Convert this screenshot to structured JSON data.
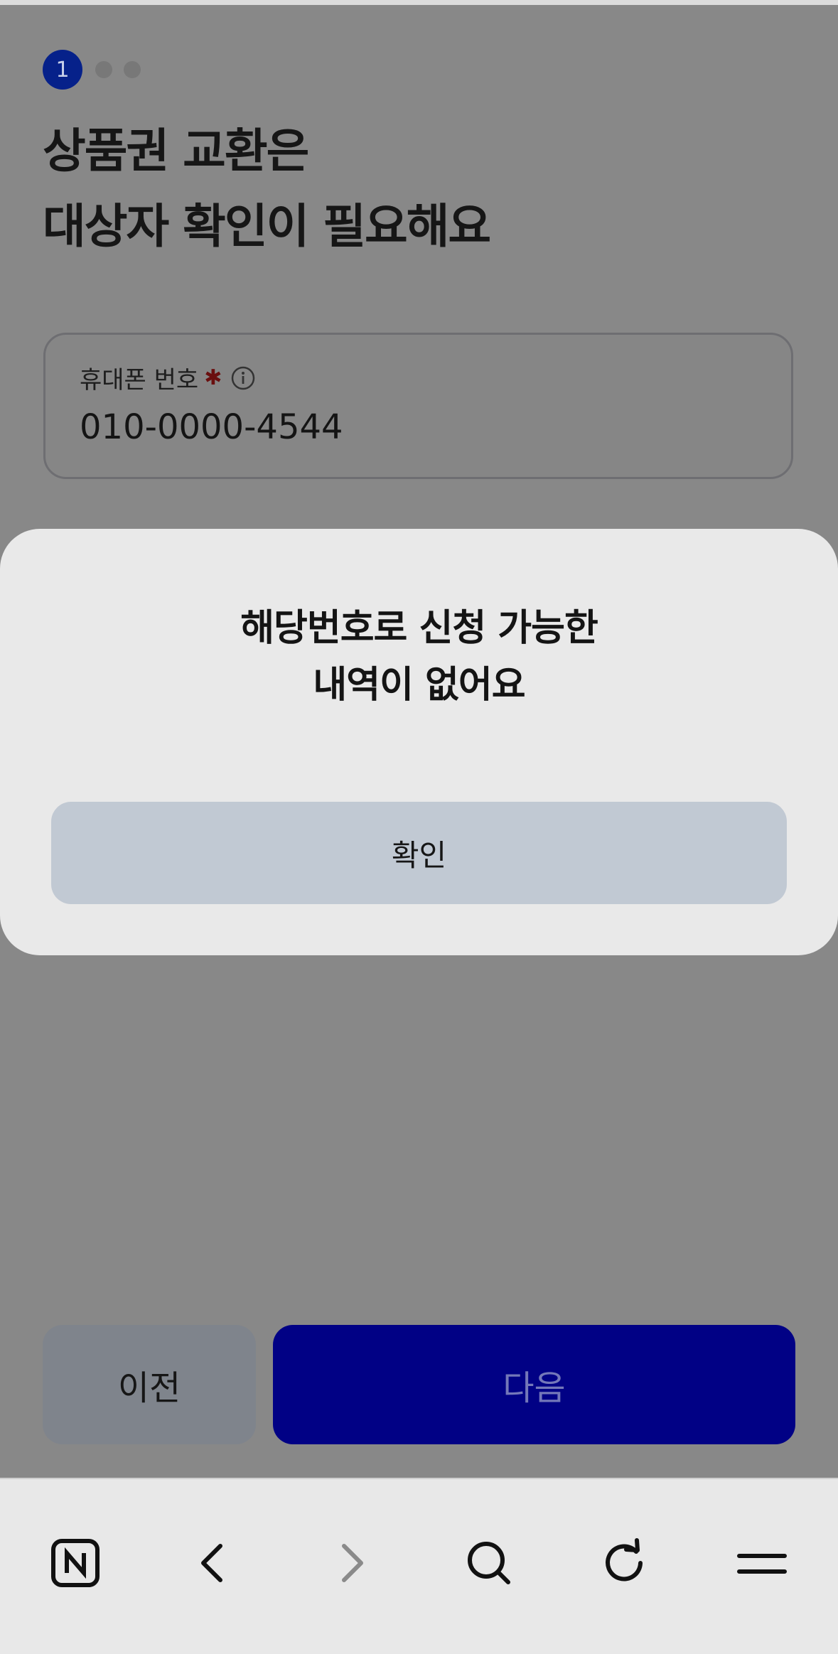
{
  "stepper": {
    "active_step": "1",
    "total_steps": 3
  },
  "page": {
    "title_line1": "상품권 교환은",
    "title_line2": "대상자 확인이 필요해요"
  },
  "phone_field": {
    "label": "휴대폰 번호",
    "required_mark": "✱",
    "value": "010-0000-4544"
  },
  "modal": {
    "message_line1": "해당번호로 신청 가능한",
    "message_line2": "내역이 없어요",
    "confirm_label": "확인"
  },
  "footer": {
    "prev_label": "이전",
    "next_label": "다음"
  },
  "browser_toolbar": {
    "icons": [
      "naver-home-icon",
      "back-icon",
      "forward-icon",
      "search-icon",
      "refresh-icon",
      "menu-icon"
    ]
  },
  "colors": {
    "overlay": "#888888",
    "modal_bg": "#e9e9e9",
    "step_active": "#06218a",
    "next_button": "#010185",
    "confirm_button": "#c1c9d3",
    "required": "#6a0f0f"
  }
}
